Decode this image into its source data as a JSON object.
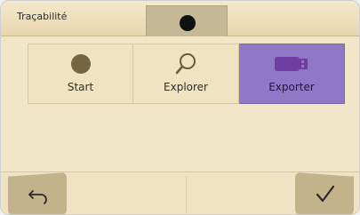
{
  "header": {
    "title": "Traçabilité",
    "status_icon": "record-dot-icon"
  },
  "menu": {
    "items": [
      {
        "label": "Start",
        "icon": "record-dot-icon",
        "active": false
      },
      {
        "label": "Explorer",
        "icon": "search-icon",
        "active": false
      },
      {
        "label": "Exporter",
        "icon": "usb-drive-icon",
        "active": true
      }
    ]
  },
  "footer": {
    "back_icon": "undo-arrow-icon",
    "confirm_icon": "checkmark-icon"
  },
  "colors": {
    "background": "#f1e6c8",
    "active_tab": "#8f78c6",
    "usb_icon": "#6f3ea1",
    "status_dot": "#111111"
  }
}
